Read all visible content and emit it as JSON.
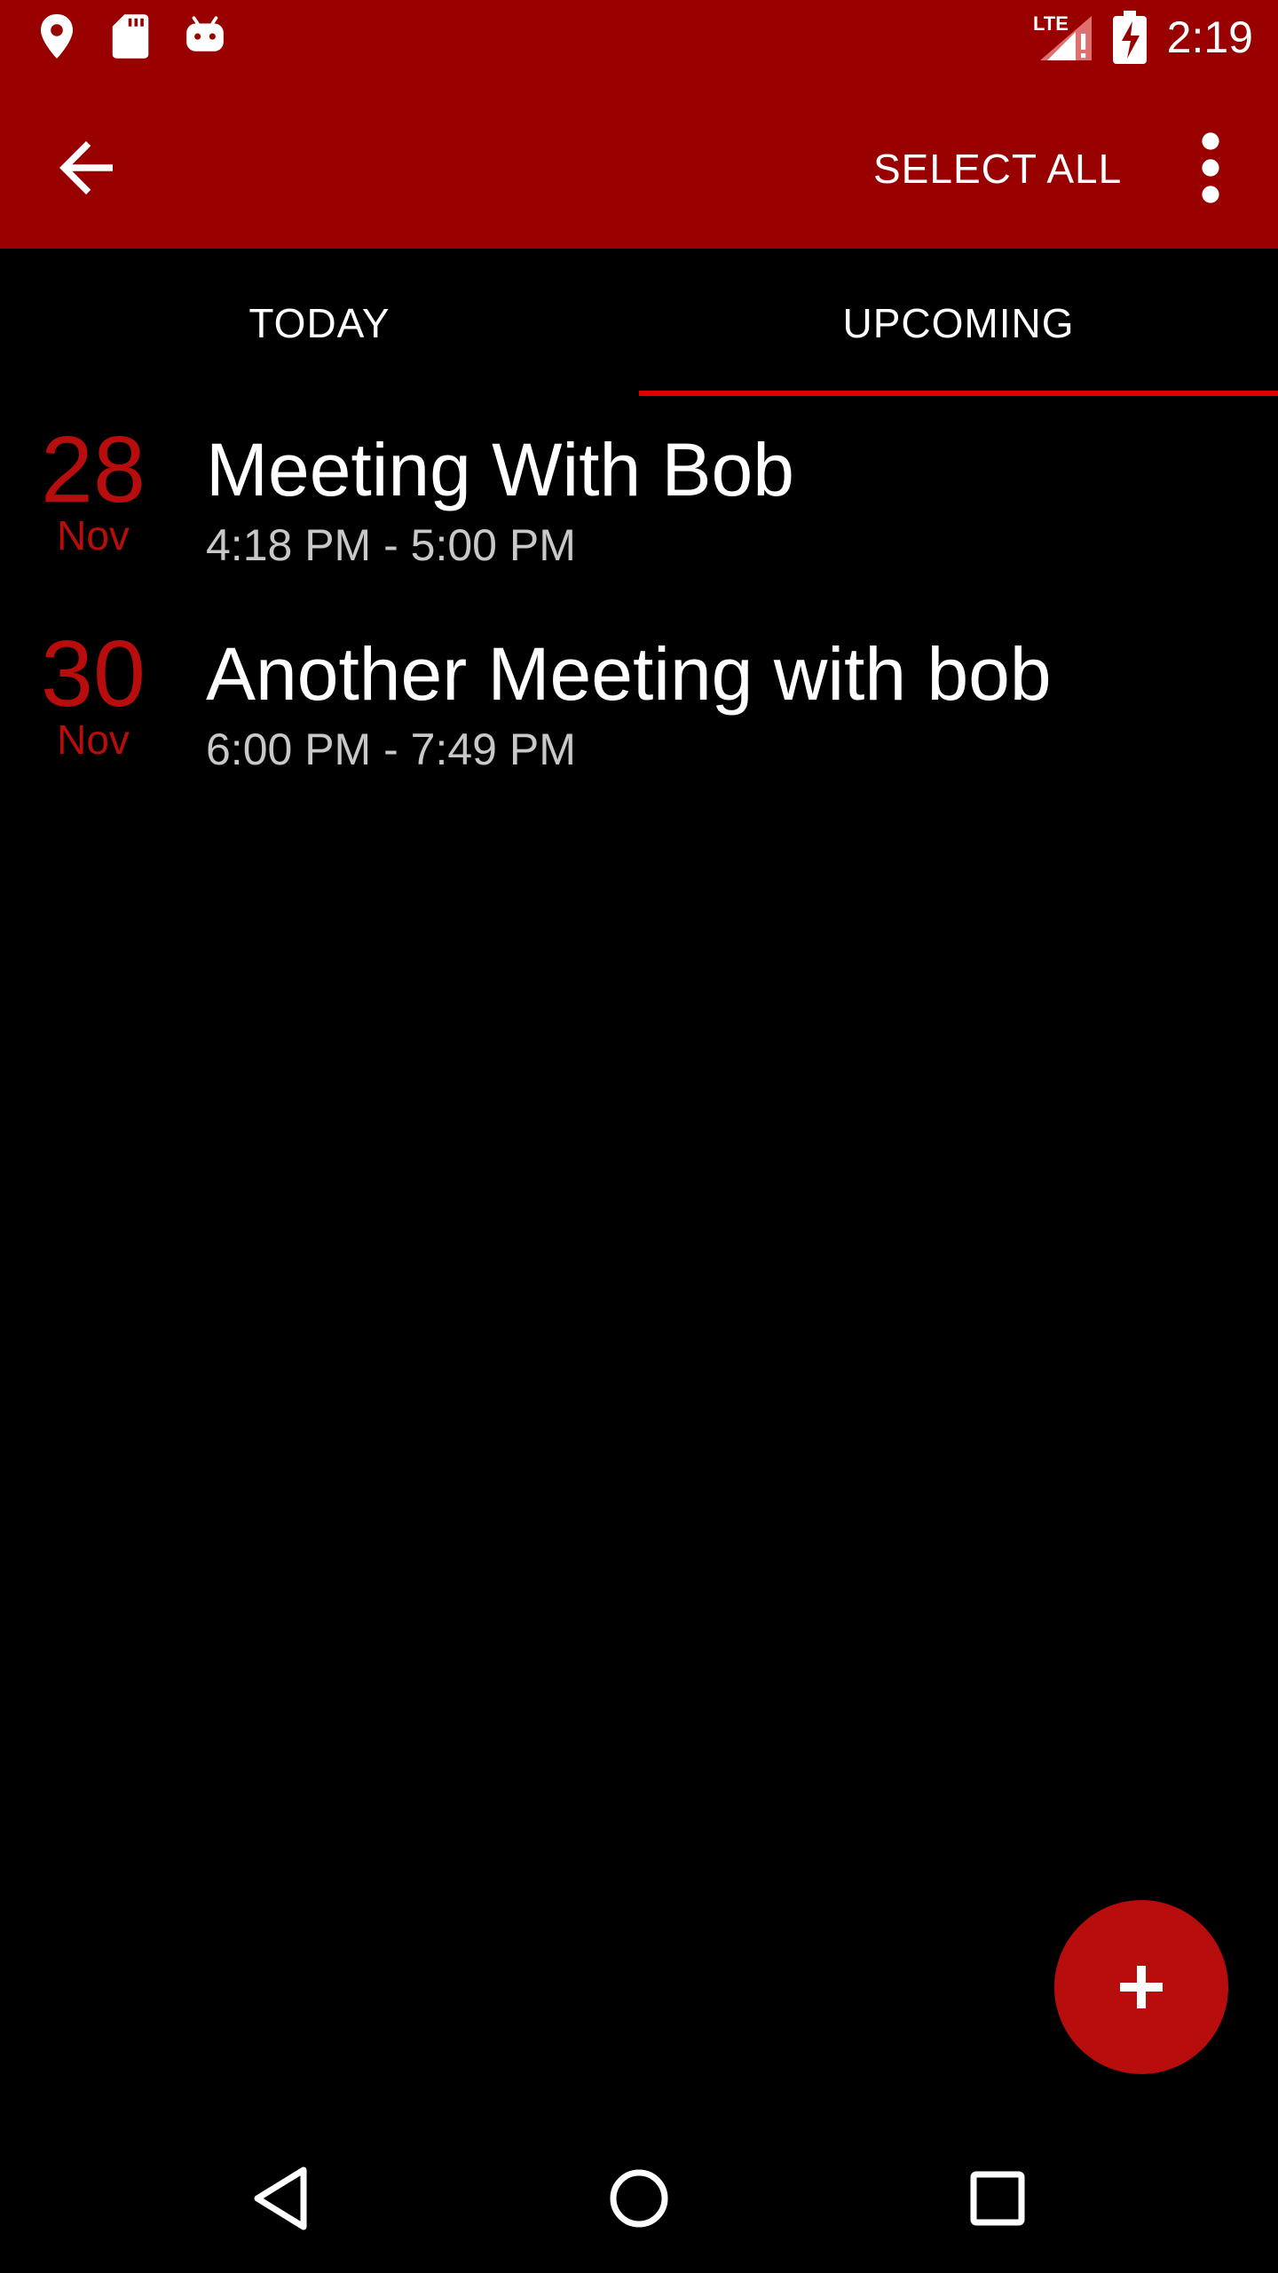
{
  "status_bar": {
    "time": "2:19",
    "network_label": "LTE",
    "icons": [
      "location-icon",
      "sd-card-icon",
      "android-icon",
      "signal-icon",
      "battery-charging-icon"
    ]
  },
  "app_bar": {
    "select_all_label": "SELECT ALL",
    "back_icon": "arrow-back-icon",
    "overflow_icon": "more-vert-icon"
  },
  "tabs": [
    {
      "label": "TODAY",
      "selected": false
    },
    {
      "label": "UPCOMING",
      "selected": true
    }
  ],
  "events": [
    {
      "day": "28",
      "month": "Nov",
      "title": "Meeting With Bob",
      "time": "4:18 PM - 5:00 PM"
    },
    {
      "day": "30",
      "month": "Nov",
      "title": "Another Meeting with bob",
      "time": "6:00 PM - 7:49 PM"
    }
  ],
  "fab": {
    "icon": "add-icon"
  },
  "nav_bar": {
    "icons": [
      "nav-back-icon",
      "nav-home-icon",
      "nav-recents-icon"
    ]
  },
  "colors": {
    "status_bar": "#990000",
    "app_bar": "#990000",
    "accent": "#b70d0d",
    "tab_indicator": "#e00000",
    "background": "#000000"
  }
}
